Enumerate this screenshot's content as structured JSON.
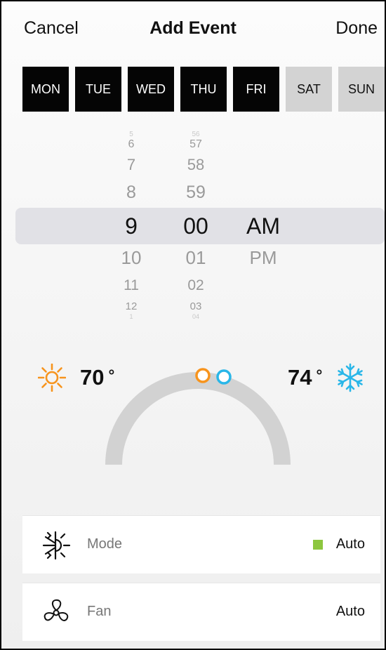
{
  "nav": {
    "cancel_label": "Cancel",
    "title": "Add Event",
    "done_label": "Done"
  },
  "days": [
    {
      "label": "MON",
      "selected": true
    },
    {
      "label": "TUE",
      "selected": true
    },
    {
      "label": "WED",
      "selected": true
    },
    {
      "label": "THU",
      "selected": true
    },
    {
      "label": "FRI",
      "selected": true
    },
    {
      "label": "SAT",
      "selected": false
    },
    {
      "label": "SUN",
      "selected": false
    }
  ],
  "time_picker": {
    "hour": {
      "above": [
        "5",
        "6",
        "7",
        "8"
      ],
      "selected": "9",
      "below": [
        "10",
        "11",
        "12",
        "1"
      ]
    },
    "minute": {
      "above": [
        "56",
        "57",
        "58",
        "59"
      ],
      "selected": "00",
      "below": [
        "01",
        "02",
        "03",
        "04"
      ]
    },
    "period": {
      "selected": "AM",
      "below": [
        "PM"
      ]
    }
  },
  "thermostat": {
    "heat_setpoint": "70",
    "cool_setpoint": "74",
    "degree_symbol": "°",
    "heat_color": "#f7941d",
    "cool_color": "#29b6e8",
    "arc_color": "#d2d2d2"
  },
  "mode": {
    "label": "Mode",
    "value": "Auto",
    "indicator_color": "#8dc63f",
    "icon": "heat-cool-mode-icon"
  },
  "fan": {
    "label": "Fan",
    "value": "Auto",
    "icon": "fan-icon"
  }
}
